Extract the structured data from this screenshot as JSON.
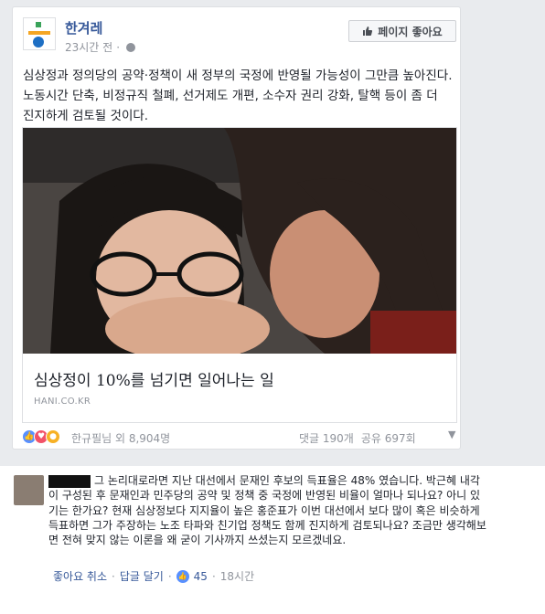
{
  "post": {
    "page_name": "한겨레",
    "time": "23시간 전",
    "dot": "·",
    "like_page_label": "페이지 좋아요",
    "text": "심상정과 정의당의 공약·정책이 새 정부의 국정에 반영될 가능성이 그만큼 높아진다. 노동시간 단축, 비정규직 철폐, 선거제도 개편, 소수자 권리 강화, 탈핵 등이 좀 더 진지하게 검토될 것이다.",
    "link": {
      "title": "심상정이 10%를 넘기면 일어나는 일",
      "domain": "HANI.CO.KR"
    },
    "reactions": {
      "reactor_text": "한규필님 외 8,904명",
      "comments": "댓글 190개",
      "shares": "공유 697회"
    }
  },
  "comment": {
    "text": "그 논리대로라면 지난 대선에서 문재인 후보의 득표율은 48% 였습니다. 박근혜 내각이 구성된 후 문재인과 민주당의 공약 및 정책 중 국정에 반영된 비율이 얼마나 되나요? 아니 있기는 한가요? 현재 심상정보다 지지율이 높은 홍준표가 이번 대선에서 보다 많이 혹은 비슷하게 득표하면 그가 주장하는 노조 타파와 친기업 정책도 함께 진지하게 검토되나요? 조금만 생각해보면 전혀 맞지 않는 이론을 왜 굳이 기사까지 쓰셨는지 모르겠네요.",
    "actions": {
      "unlike": "좋아요 취소",
      "reply": "답글 달기",
      "like_count": "45",
      "time": "18시간",
      "dot": "·"
    }
  },
  "colors": {
    "link_blue": "#365899",
    "muted": "#90949c",
    "like_blue": "#5890ff"
  }
}
